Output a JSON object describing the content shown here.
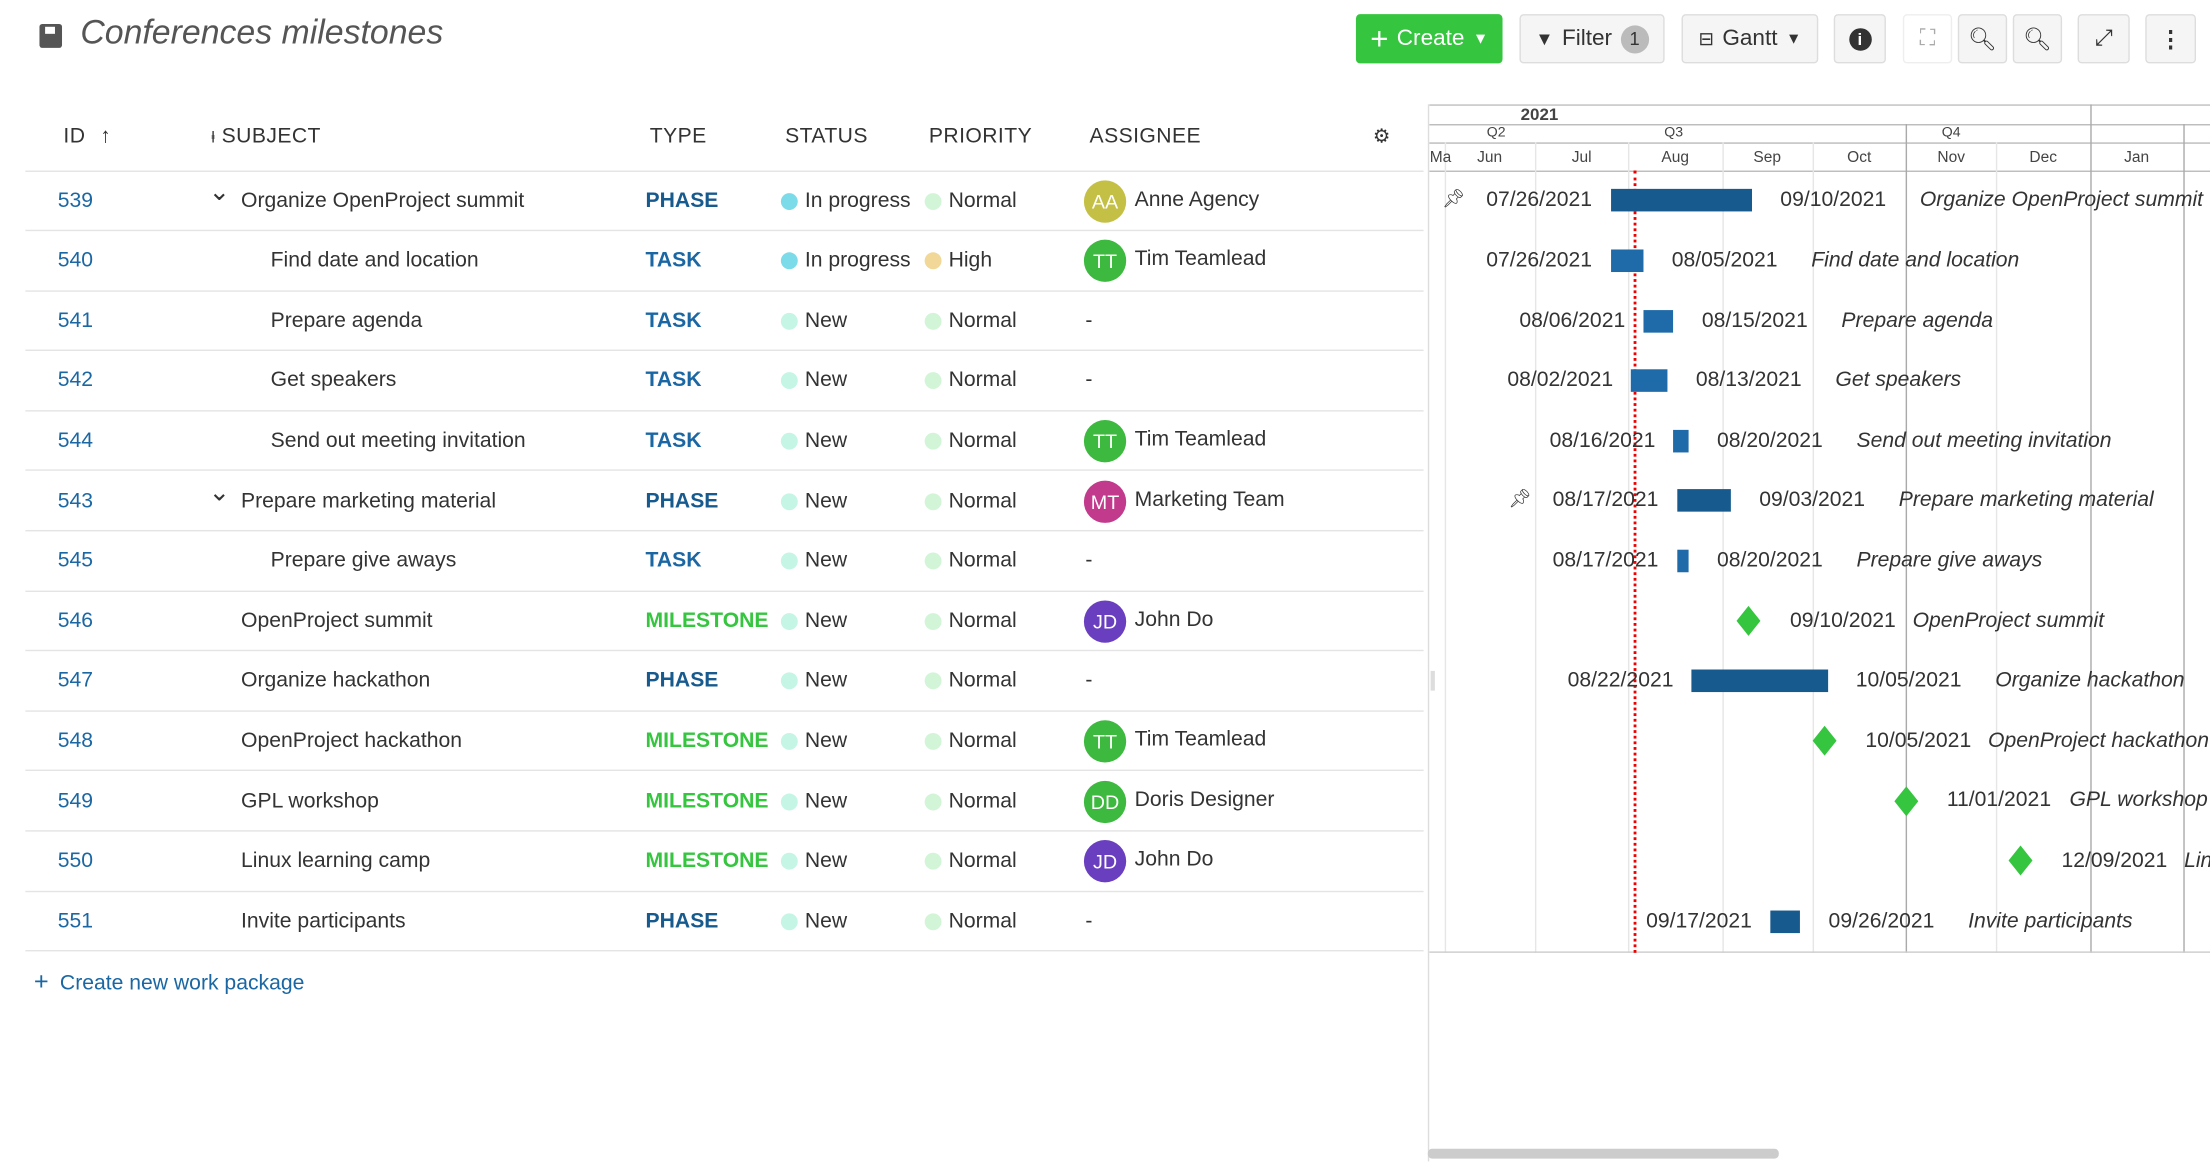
{
  "header": {
    "title": "Conferences milestones",
    "save_icon": "floppy-icon"
  },
  "toolbar": {
    "create_label": "Create",
    "filter_label": "Filter",
    "filter_count": "1",
    "view_label": "Gantt",
    "colors": {
      "create": "#35c53f"
    }
  },
  "table": {
    "columns": {
      "id": "ID",
      "subject": "SUBJECT",
      "type": "TYPE",
      "status": "STATUS",
      "priority": "PRIORITY",
      "assignee": "ASSIGNEE"
    },
    "rows": [
      {
        "id": "539",
        "subject": "Organize OpenProject summit",
        "level": 0,
        "collapsible": true,
        "type": "PHASE",
        "status": "In progress",
        "priority": "Normal",
        "assignee": "Anne Agency",
        "initials": "AA",
        "avatar_color": "#c4c046"
      },
      {
        "id": "540",
        "subject": "Find date and location",
        "level": 1,
        "type": "TASK",
        "status": "In progress",
        "priority": "High",
        "assignee": "Tim Teamlead",
        "initials": "TT",
        "avatar_color": "#3cb93e"
      },
      {
        "id": "541",
        "subject": "Prepare agenda",
        "level": 1,
        "type": "TASK",
        "status": "New",
        "priority": "Normal",
        "assignee": "-"
      },
      {
        "id": "542",
        "subject": "Get speakers",
        "level": 1,
        "type": "TASK",
        "status": "New",
        "priority": "Normal",
        "assignee": "-"
      },
      {
        "id": "544",
        "subject": "Send out meeting invitation",
        "level": 1,
        "type": "TASK",
        "status": "New",
        "priority": "Normal",
        "assignee": "Tim Teamlead",
        "initials": "TT",
        "avatar_color": "#3cb93e"
      },
      {
        "id": "543",
        "subject": "Prepare marketing material",
        "level": 0,
        "collapsible": true,
        "type": "PHASE",
        "status": "New",
        "priority": "Normal",
        "assignee": "Marketing Team",
        "initials": "MT",
        "avatar_color": "#c23a8c"
      },
      {
        "id": "545",
        "subject": "Prepare give aways",
        "level": 1,
        "type": "TASK",
        "status": "New",
        "priority": "Normal",
        "assignee": "-"
      },
      {
        "id": "546",
        "subject": "OpenProject summit",
        "level": 0,
        "type": "MILESTONE",
        "status": "New",
        "priority": "Normal",
        "assignee": "John Do",
        "initials": "JD",
        "avatar_color": "#6a3fbf"
      },
      {
        "id": "547",
        "subject": "Organize hackathon",
        "level": 0,
        "type": "PHASE",
        "status": "New",
        "priority": "Normal",
        "assignee": "-"
      },
      {
        "id": "548",
        "subject": "OpenProject hackathon",
        "level": 0,
        "type": "MILESTONE",
        "status": "New",
        "priority": "Normal",
        "assignee": "Tim Teamlead",
        "initials": "TT",
        "avatar_color": "#3cb93e"
      },
      {
        "id": "549",
        "subject": "GPL workshop",
        "level": 0,
        "type": "MILESTONE",
        "status": "New",
        "priority": "Normal",
        "assignee": "Doris Designer",
        "initials": "DD",
        "avatar_color": "#3cb93e"
      },
      {
        "id": "550",
        "subject": "Linux learning camp",
        "level": 0,
        "type": "MILESTONE",
        "status": "New",
        "priority": "Normal",
        "assignee": "John Do",
        "initials": "JD",
        "avatar_color": "#6a3fbf"
      },
      {
        "id": "551",
        "subject": "Invite participants",
        "level": 0,
        "type": "PHASE",
        "status": "New",
        "priority": "Normal",
        "assignee": "-"
      }
    ],
    "create_label": "Create new work package",
    "type_colors": {
      "PHASE": "#175a8e",
      "TASK": "#1a67a3",
      "MILESTONE": "#35c53f"
    },
    "status_colors": {
      "In progress": "#7bdbe8",
      "New": "#c5f5e5"
    },
    "priority_colors": {
      "Normal": "#d2f5d8",
      "High": "#f1d898"
    }
  },
  "gantt": {
    "year": "2021",
    "quarters": [
      "Q2",
      "Q3",
      "Q4"
    ],
    "months": [
      "Ma",
      "Jun",
      "Jul",
      "Aug",
      "Sep",
      "Oct",
      "Nov",
      "Dec",
      "Jan"
    ],
    "today": "2021-08-03",
    "bar_colors": {
      "PHASE": "#175a8e",
      "TASK": "#1f6aa8",
      "MILESTONE": "#35c53f"
    },
    "items": [
      {
        "start": "07/26/2021",
        "end": "09/10/2021",
        "label": "Organize OpenProject summit",
        "pinned": true
      },
      {
        "start": "07/26/2021",
        "end": "08/05/2021",
        "label": "Find date and location"
      },
      {
        "start": "08/06/2021",
        "end": "08/15/2021",
        "label": "Prepare agenda"
      },
      {
        "start": "08/02/2021",
        "end": "08/13/2021",
        "label": "Get speakers"
      },
      {
        "start": "08/16/2021",
        "end": "08/20/2021",
        "label": "Send out meeting invitation"
      },
      {
        "start": "08/17/2021",
        "end": "09/03/2021",
        "label": "Prepare marketing material",
        "pinned": true
      },
      {
        "start": "08/17/2021",
        "end": "08/20/2021",
        "label": "Prepare give aways"
      },
      {
        "date": "09/10/2021",
        "label": "OpenProject summit"
      },
      {
        "start": "08/22/2021",
        "end": "10/05/2021",
        "label": "Organize hackathon"
      },
      {
        "date": "10/05/2021",
        "label": "OpenProject hackathon"
      },
      {
        "date": "11/01/2021",
        "label": "GPL workshop"
      },
      {
        "date": "12/09/2021",
        "label": "Linux learning camp"
      },
      {
        "start": "09/17/2021",
        "end": "09/26/2021",
        "label": "Invite participants"
      }
    ]
  }
}
